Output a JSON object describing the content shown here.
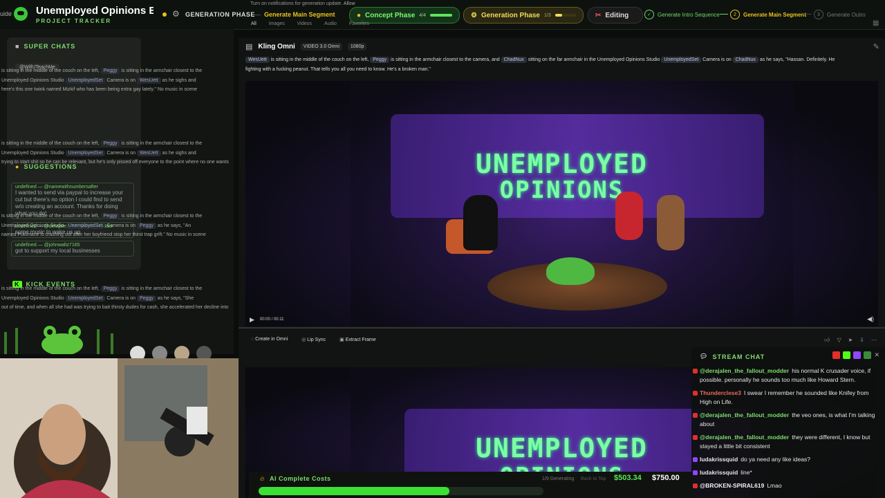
{
  "app": {
    "title": "Unemployed Opinions E...",
    "subtitle": "PROJECT TRACKER",
    "left_edge_text": "uide"
  },
  "phase_bar": {
    "current_phase": "GENERATION PHASE",
    "current_action": "Generate Main Segment",
    "phases": [
      {
        "label": "Concept Phase",
        "count": "4/4",
        "progress": 1.0
      },
      {
        "label": "Generation Phase",
        "count": "1/3",
        "progress": 0.33
      },
      {
        "label": "Editing",
        "count": "",
        "progress": 0
      }
    ],
    "steps": [
      {
        "label": "Generate Intro Sequence",
        "state": "done",
        "marker": "✓"
      },
      {
        "label": "Generate Main Segment",
        "state": "active",
        "marker": "2"
      },
      {
        "label": "Generate Outro",
        "state": "pending",
        "marker": "3"
      }
    ],
    "notification": "Turn on notifications for generation update.",
    "notification_action": "Allow",
    "filter_tabs": [
      "All",
      "Images",
      "Videos",
      "Audio"
    ],
    "favorites_label": "Favorites"
  },
  "left_panel": {
    "super_chats_label": "SUPER CHATS",
    "super_chat_user": "@WillUTeachMe",
    "suggestions_label": "SUGGESTIONS",
    "suggestions": [
      {
        "user": "undefined — @namewithnumbersafter",
        "text": "I wanted to send via paypal to increase your cut but there's no option I could find to send w/o creating an account. Thanks for doing what you do!"
      },
      {
        "user": "undefined — @derajalen_the_fallout_modder",
        "text": "some music to wake us up"
      },
      {
        "user": "undefined — @johnwaltz7165",
        "text": "got to support my local businesses"
      }
    ],
    "kick_events_label": "KICK EVENTS",
    "prompt_rows": [
      {
        "a": "is sitting in the middle of the couch on the left,",
        "b": "Peggy",
        "c": "is sitting in the armchair closest to the"
      },
      {
        "a": "Unemployed Opinions Studio",
        "b": "UnemployedSet",
        "c": "Camera is on",
        "d": "WesUett",
        "e": "as he sighs and"
      },
      {
        "a": "here's this one twink named Mizkif who has been being extra gay lately.\" No music in scene"
      },
      {
        "a": "is sitting in the middle of the couch on the left,",
        "b": "Peggy",
        "c": "is sitting in the armchair closest to the"
      },
      {
        "a": "Unemployed Opinions Studio",
        "b": "UnemployedSet",
        "c": "Camera is on",
        "d": "WesUett",
        "e": "as he sighs and"
      },
      {
        "a": "trying to start shit so he can be relevant, but he's only pissed off everyone to the point where no one wants"
      },
      {
        "a": "is sitting in the middle of the couch on the left,",
        "b": "Peggy",
        "c": "is sitting in the armchair closest to the"
      },
      {
        "a": "Unemployed Opinions Studio",
        "b": "UnemployedSet",
        "c": "Camera is on",
        "d": "Peggy",
        "e": "as he says, \"An"
      },
      {
        "a": "named Pokimane is crashing out after her boyfriend stop her thirst trap grift.\" No music in scene"
      },
      {
        "a": "is sitting in the middle of the couch on the left,",
        "b": "Peggy",
        "c": "is sitting in the armchair closest to the"
      },
      {
        "a": "Unemployed Opinions Studio",
        "b": "UnemployedSet",
        "c": "Camera is on",
        "d": "Peggy",
        "e": "as he says, \"She"
      },
      {
        "a": "out of time, and when all she had was trying to bait thirsty dudes for cash, she accelerated her decline into"
      }
    ]
  },
  "main": {
    "model": "Kling Omni",
    "badge_version": "VIDEO 3.0 Omni",
    "badge_res": "1080p",
    "prompt": {
      "t1": "WesUett",
      "t2": "is sitting in the middle of the couch on the left,",
      "t3": "Peggy",
      "t4": "is sitting in the armchair closest to the camera, and",
      "t5": "ChadNux",
      "t6": "sitting on the far armchair in the Unemployed Opinions Studio",
      "t7": "UnemployedSet",
      "t8": "Camera is on",
      "t9": "ChadNux",
      "t10": "as he says, \"Hassan. Definitely. He",
      "line2": "fighting with a fucking peanut. That tells you all you need to know. He's a broken man.\""
    },
    "video": {
      "sign_line1": "UNEMPLOYED",
      "sign_line2": "OPINIONS",
      "time": "00:00 / 00:11"
    },
    "actions": [
      "Create in Omni",
      "Lip Sync",
      "Extract Frame"
    ]
  },
  "chat": {
    "title": "STREAM CHAT",
    "messages": [
      {
        "user": "@derajalen_the_fallout_modder",
        "text": "his normal K crusader voice, if possible. personally he sounds too much like Howard Stern.",
        "platform": "youtube"
      },
      {
        "user": "Thunderclese3",
        "text": "I swear I remember he sounded like Knifey from High on Life.",
        "platform": "youtube"
      },
      {
        "user": "@derajalen_the_fallout_modder",
        "text": "the veo ones, is what I'm talking about",
        "platform": "youtube"
      },
      {
        "user": "@derajalen_the_fallout_modder",
        "text": "they were different, I know but stayed a little bit consistent",
        "platform": "youtube"
      },
      {
        "user": "ludakrissquid",
        "text": "do ya need any like ideas?",
        "platform": "twitch"
      },
      {
        "user": "ludakrissquid",
        "text": "line*",
        "platform": "twitch"
      },
      {
        "user": "@BROKEN-SPIRAL619",
        "text": "Lmao",
        "platform": "youtube"
      }
    ]
  },
  "costs": {
    "label": "AI Complete Costs",
    "status": "1/9 Generating",
    "back_to_top": "Back to Top",
    "spent": "$503.34",
    "budget": "$750.00",
    "progress": 0.67
  },
  "colors": {
    "accent_green": "#5ce65a",
    "phase_yellow": "#e8c21c",
    "youtube_red": "#e0302c",
    "twitch_purple": "#9146ff"
  }
}
